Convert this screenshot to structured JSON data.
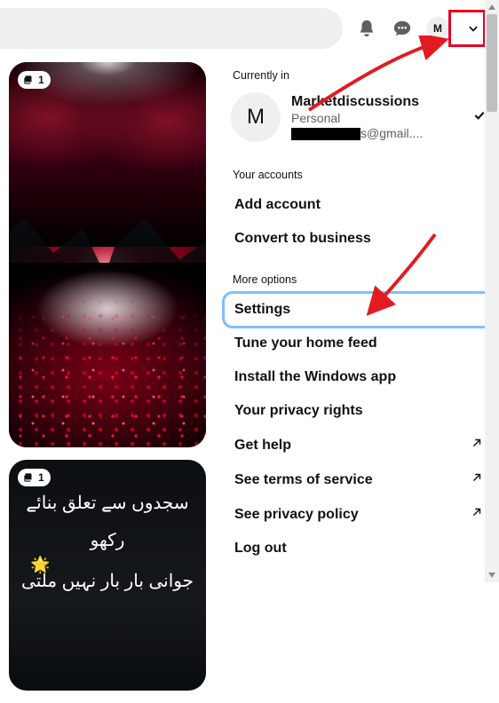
{
  "topbar": {
    "avatar_initial": "M"
  },
  "feed": {
    "pins": [
      {
        "collection_count": "1"
      },
      {
        "collection_count": "1",
        "text_line1": "سجدوں سے تعلق بنائے رکھو",
        "text_line2": "جوانی بار بار نہیں ملتی"
      }
    ]
  },
  "dropdown": {
    "currently_in_label": "Currently in",
    "account": {
      "avatar_initial": "M",
      "name": "Marketdiscussions",
      "type": "Personal",
      "email_suffix": "s@gmail...."
    },
    "your_accounts_label": "Your accounts",
    "your_accounts": [
      {
        "label": "Add account"
      },
      {
        "label": "Convert to business"
      }
    ],
    "more_options_label": "More options",
    "more_options": [
      {
        "label": "Settings",
        "selected": true
      },
      {
        "label": "Tune your home feed"
      },
      {
        "label": "Install the Windows app"
      },
      {
        "label": "Your privacy rights"
      },
      {
        "label": "Get help",
        "external": true
      },
      {
        "label": "See terms of service",
        "external": true
      },
      {
        "label": "See privacy policy",
        "external": true
      },
      {
        "label": "Log out"
      }
    ]
  },
  "annotations": {
    "arrow_color": "#e21b22"
  }
}
